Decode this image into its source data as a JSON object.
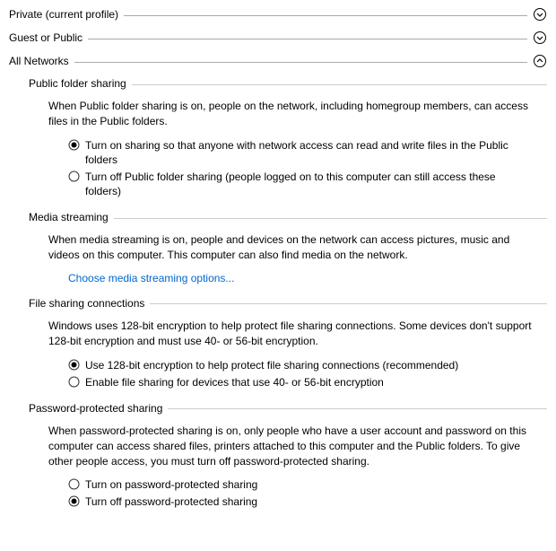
{
  "sections": {
    "private": {
      "label": "Private (current profile)"
    },
    "guest": {
      "label": "Guest or Public"
    },
    "all": {
      "label": "All Networks"
    }
  },
  "public_folder_sharing": {
    "title": "Public folder sharing",
    "desc": "When Public folder sharing is on, people on the network, including homegroup members, can access files in the Public folders.",
    "options": [
      "Turn on sharing so that anyone with network access can read and write files in the Public folders",
      "Turn off Public folder sharing (people logged on to this computer can still access these folders)"
    ],
    "selected": 0
  },
  "media_streaming": {
    "title": "Media streaming",
    "desc": "When media streaming is on, people and devices on the network can access pictures, music and videos on this computer. This computer can also find media on the network.",
    "link": "Choose media streaming options..."
  },
  "file_sharing": {
    "title": "File sharing connections",
    "desc": "Windows uses 128-bit encryption to help protect file sharing connections. Some devices don't support 128-bit encryption and must use 40- or 56-bit encryption.",
    "options": [
      "Use 128-bit encryption to help protect file sharing connections (recommended)",
      "Enable file sharing for devices that use 40- or 56-bit encryption"
    ],
    "selected": 0
  },
  "password_sharing": {
    "title": "Password-protected sharing",
    "desc": "When password-protected sharing is on, only people who have a user account and password on this computer can access shared files, printers attached to this computer and the Public folders. To give other people access, you must turn off password-protected sharing.",
    "options": [
      "Turn on password-protected sharing",
      "Turn off password-protected sharing"
    ],
    "selected": 1
  }
}
